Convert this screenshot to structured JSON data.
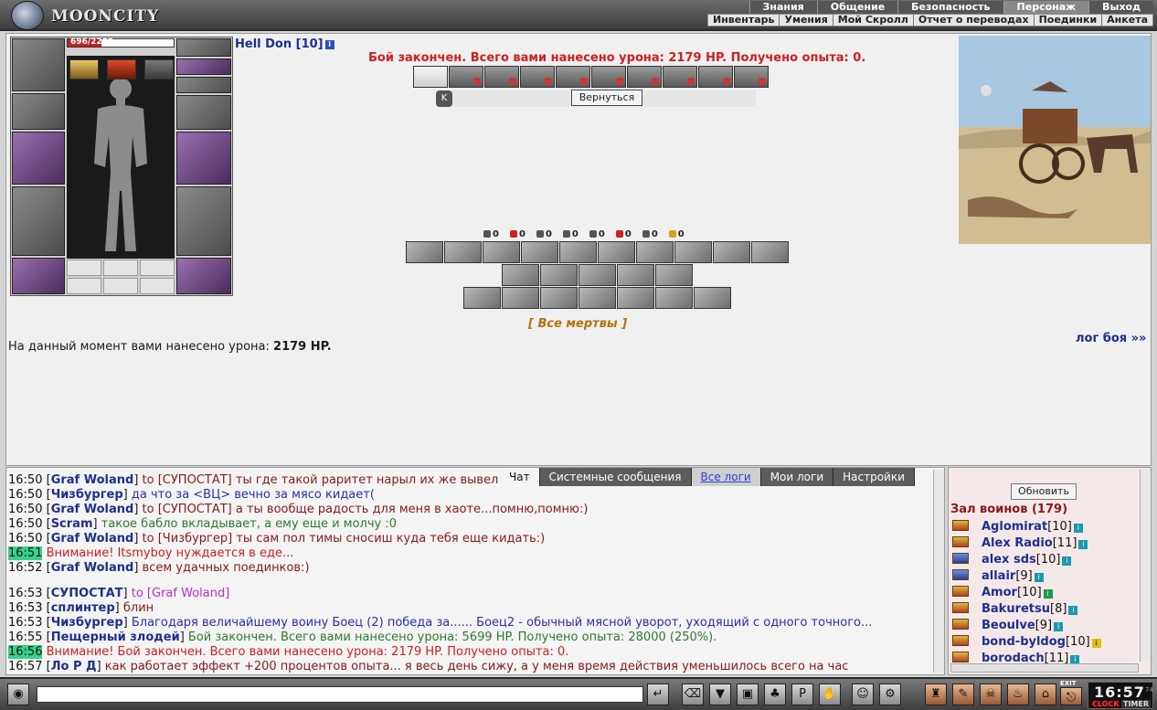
{
  "app": {
    "logo": "MOONCITY"
  },
  "top_menu": [
    "Знания",
    "Общение",
    "Безопасность",
    "Персонаж",
    "Выход"
  ],
  "sub_menu": [
    "Инвентарь",
    "Умения",
    "Мой Скролл",
    "Отчет о переводах",
    "Поединки",
    "Анкета"
  ],
  "character": {
    "name": "Hell Don [10]",
    "hp_text": "696/2209",
    "hp_fraction": 0.315
  },
  "battle": {
    "result": "Бой закончен. Всего вами нанесено урона: 2179 HP. Получено опыта: 0.",
    "return_label": "Вернуться",
    "counters": [
      "0",
      "0",
      "0",
      "0",
      "0",
      "0",
      "0",
      "0"
    ],
    "all_dead": "[ Все мертвы ]",
    "damage_prefix": "На данный момент вами нанесено урона: ",
    "damage_value": "2179 HP.",
    "log_link": "лог боя »»"
  },
  "chat": {
    "tabs": [
      "Чат",
      "Системные сообщения",
      "Все логи",
      "Мои логи",
      "Настройки"
    ],
    "messages": [
      {
        "time": "16:50",
        "who": "Graf Woland",
        "to": "to [СУПОСТАТ]",
        "text": " ты где такой раритет нарыл их же вывел",
        "cls": "dred"
      },
      {
        "time": "16:50",
        "who": "Чизбургер",
        "to": "",
        "text": " да что за <ВЦ> вечно за мясо кидает(",
        "cls": "blue"
      },
      {
        "time": "16:50",
        "who": "Graf Woland",
        "to": "to [СУПОСТАТ]",
        "text": " а ты вообще радость для меня в хаоте...помню,помню:)",
        "cls": "dred"
      },
      {
        "time": "16:50",
        "who": "Scram",
        "to": "",
        "text": " такое бабло вкладывает, а ему еще и молчу :0",
        "cls": "green"
      },
      {
        "time": "16:50",
        "who": "Graf Woland",
        "to": "to [Чизбургер]",
        "text": " ты сам пол тимы сносиш куда тебя еще кидать:)",
        "cls": "dred"
      },
      {
        "time": "16:51",
        "who": "",
        "to": "",
        "text": "Внимание! Itsmyboy нуждается в еде...",
        "cls": "red"
      },
      {
        "time": "16:52",
        "who": "Graf Woland",
        "to": "",
        "text": " всем удачных поединков:)",
        "cls": "dred"
      },
      {
        "time": "16:53",
        "who": "СУПОСТАТ",
        "to": "to [Graf Woland]",
        "text": "",
        "cls": "purple"
      },
      {
        "time": "16:53",
        "who": "сплинтер",
        "to": "",
        "text": " блин",
        "cls": "dred"
      },
      {
        "time": "16:53",
        "who": "Чизбургер",
        "to": "",
        "text": " Благодаря величайшему воину Боец (2) победа за...... Боец2 - обычный мясной уворот, уходящий с одного точного...",
        "cls": "blue"
      },
      {
        "time": "16:55",
        "who": "Пещерный злодей",
        "to": "",
        "text": " Бой закончен. Всего вами нанесено урона: 5699 HP. Получено опыта: 28000 (250%).",
        "cls": "green"
      },
      {
        "time": "16:56",
        "who": "",
        "to": "",
        "text": "Внимание! Бой закончен. Всего вами нанесено урона: 2179 HP. Получено опыта: 0.",
        "cls": "red"
      },
      {
        "time": "16:57",
        "who": "Ло Р Д",
        "to": "",
        "text": " как работает эффект +200 процентов опыта... я весь день сижу, а у меня время действия уменьшилось всего на час",
        "cls": "dred"
      }
    ]
  },
  "hall": {
    "refresh_label": "Обновить",
    "title": "Зал воинов (179)",
    "warriors": [
      {
        "name": "Aglomirat",
        "level": "[10]"
      },
      {
        "name": "Alex Radio",
        "level": "[11]"
      },
      {
        "name": "alex sds",
        "level": "[10]"
      },
      {
        "name": "allair",
        "level": "[9]"
      },
      {
        "name": "Amor",
        "level": "[10]"
      },
      {
        "name": "Bakuretsu",
        "level": "[8]"
      },
      {
        "name": "Beoulve",
        "level": "[9]"
      },
      {
        "name": "bond-byldog",
        "level": "[10]"
      },
      {
        "name": "borodach",
        "level": "[11]"
      }
    ]
  },
  "clock": {
    "time": "16:57",
    "suffix": "74",
    "clock_label": "CLOCK",
    "timer_label": "TIMER",
    "exit_label": "EXIT"
  },
  "colors": {
    "accent_red": "#d02020",
    "nick_blue": "#1e2f8f",
    "highlight_green": "#33d48a"
  }
}
